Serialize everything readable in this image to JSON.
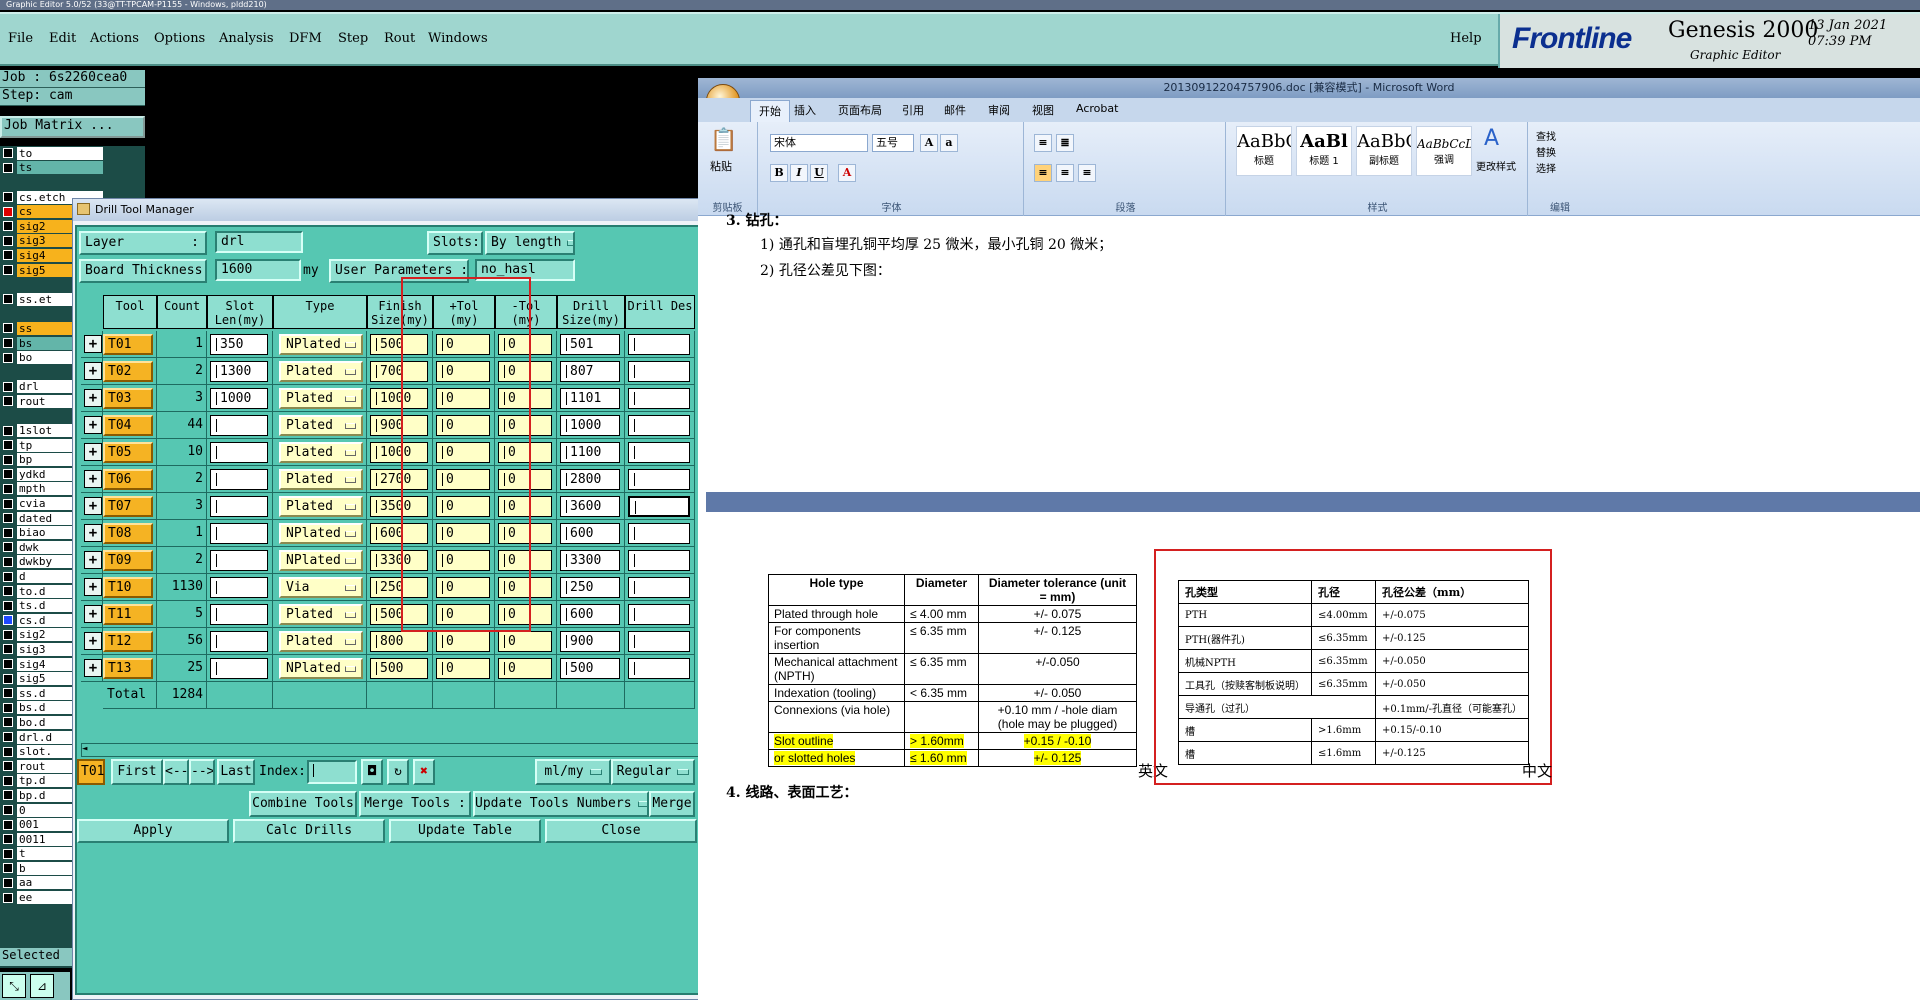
{
  "os_title": "Graphic Editor 5.0/52 (33@TT-TPCAM-P1155 - Windows, pldd210)",
  "genesis": {
    "menu": [
      "File",
      "Edit",
      "Actions",
      "Options",
      "Analysis",
      "DFM",
      "Step",
      "Rout",
      "Windows"
    ],
    "help": "Help",
    "brand_logo": "Frontline",
    "product": "Genesis 2000",
    "product_sub": "Graphic Editor",
    "date": "13 Jan 2021",
    "time": "07:39 PM",
    "job": "Job : 6s2260cea0",
    "step": "Step: cam",
    "job_matrix": "Job Matrix ...",
    "selected": "Selected",
    "layers": [
      {
        "name": "to",
        "style": "white",
        "cb": "off"
      },
      {
        "name": "ts",
        "style": "teal",
        "cb": "off"
      },
      {
        "name": "",
        "style": "blank",
        "cb": "none"
      },
      {
        "name": "cs.etch",
        "style": "white",
        "cb": "off"
      },
      {
        "name": "cs",
        "style": "orange",
        "cb": "red"
      },
      {
        "name": "sig2",
        "style": "orange",
        "cb": "off"
      },
      {
        "name": "sig3",
        "style": "orange",
        "cb": "off"
      },
      {
        "name": "sig4",
        "style": "orange",
        "cb": "off"
      },
      {
        "name": "sig5",
        "style": "orange",
        "cb": "off"
      },
      {
        "name": "",
        "style": "blank",
        "cb": "none"
      },
      {
        "name": "ss.et",
        "style": "white",
        "cb": "off"
      },
      {
        "name": "",
        "style": "blank",
        "cb": "none"
      },
      {
        "name": "ss",
        "style": "orange",
        "cb": "off"
      },
      {
        "name": "bs",
        "style": "teal",
        "cb": "off"
      },
      {
        "name": "bo",
        "style": "white",
        "cb": "off"
      },
      {
        "name": "",
        "style": "blank",
        "cb": "none"
      },
      {
        "name": "drl",
        "style": "white",
        "cb": "off"
      },
      {
        "name": "rout",
        "style": "white",
        "cb": "off"
      },
      {
        "name": "",
        "style": "blank",
        "cb": "none"
      },
      {
        "name": "1slot",
        "style": "white",
        "cb": "off"
      },
      {
        "name": "tp",
        "style": "white",
        "cb": "off"
      },
      {
        "name": "bp",
        "style": "white",
        "cb": "off"
      },
      {
        "name": "ydkd",
        "style": "white",
        "cb": "off"
      },
      {
        "name": "mpth",
        "style": "white",
        "cb": "off"
      },
      {
        "name": "cvia",
        "style": "white",
        "cb": "off"
      },
      {
        "name": "dated",
        "style": "white",
        "cb": "off"
      },
      {
        "name": "biao",
        "style": "white",
        "cb": "off"
      },
      {
        "name": "dwk",
        "style": "white",
        "cb": "off"
      },
      {
        "name": "dwkby",
        "style": "white",
        "cb": "off"
      },
      {
        "name": "d",
        "style": "white",
        "cb": "off"
      },
      {
        "name": "to.d",
        "style": "white",
        "cb": "off"
      },
      {
        "name": "ts.d",
        "style": "white",
        "cb": "off"
      },
      {
        "name": "cs.d",
        "style": "white",
        "cb": "on"
      },
      {
        "name": "sig2",
        "style": "white",
        "cb": "off"
      },
      {
        "name": "sig3",
        "style": "white",
        "cb": "off"
      },
      {
        "name": "sig4",
        "style": "white",
        "cb": "off"
      },
      {
        "name": "sig5",
        "style": "white",
        "cb": "off"
      },
      {
        "name": "ss.d",
        "style": "white",
        "cb": "off"
      },
      {
        "name": "bs.d",
        "style": "white",
        "cb": "off"
      },
      {
        "name": "bo.d",
        "style": "white",
        "cb": "off"
      },
      {
        "name": "drl.d",
        "style": "white",
        "cb": "off"
      },
      {
        "name": "slot.",
        "style": "white",
        "cb": "off"
      },
      {
        "name": "rout",
        "style": "white",
        "cb": "off"
      },
      {
        "name": "tp.d",
        "style": "white",
        "cb": "off"
      },
      {
        "name": "bp.d",
        "style": "white",
        "cb": "off"
      },
      {
        "name": "0",
        "style": "white",
        "cb": "off"
      },
      {
        "name": "001",
        "style": "white",
        "cb": "off"
      },
      {
        "name": "0011",
        "style": "white",
        "cb": "off"
      },
      {
        "name": "t",
        "style": "white",
        "cb": "off"
      },
      {
        "name": "b",
        "style": "white",
        "cb": "off"
      },
      {
        "name": "aa",
        "style": "white",
        "cb": "off"
      },
      {
        "name": "ee",
        "style": "white",
        "cb": "off"
      }
    ]
  },
  "drill_tool_manager": {
    "title": "Drill Tool Manager",
    "layer_label": "Layer",
    "layer_value": "drl",
    "slots_label": "Slots:",
    "slots_value": "By length",
    "board_thickness_label": "Board Thickness :",
    "board_thickness_value": "1600",
    "board_thickness_unit": "my",
    "user_params_label": "User Parameters :",
    "user_params_value": "no_hasl",
    "columns": [
      "Tool",
      "Count",
      "Slot Len(my)",
      "Type",
      "Finish Size(my)",
      "+Tol (my)",
      "-Tol (my)",
      "Drill Size(my)",
      "Drill Des"
    ],
    "rows": [
      {
        "tool": "T01",
        "count": "1",
        "slot": "350",
        "type": "NPlated",
        "finish": "500",
        "ptol": "0",
        "mtol": "0",
        "drill": "501"
      },
      {
        "tool": "T02",
        "count": "2",
        "slot": "1300",
        "type": "Plated",
        "finish": "700",
        "ptol": "0",
        "mtol": "0",
        "drill": "807"
      },
      {
        "tool": "T03",
        "count": "3",
        "slot": "1000",
        "type": "Plated",
        "finish": "1000",
        "ptol": "0",
        "mtol": "0",
        "drill": "1101"
      },
      {
        "tool": "T04",
        "count": "44",
        "slot": "",
        "type": "Plated",
        "finish": "900",
        "ptol": "0",
        "mtol": "0",
        "drill": "1000"
      },
      {
        "tool": "T05",
        "count": "10",
        "slot": "",
        "type": "Plated",
        "finish": "1000",
        "ptol": "0",
        "mtol": "0",
        "drill": "1100"
      },
      {
        "tool": "T06",
        "count": "2",
        "slot": "",
        "type": "Plated",
        "finish": "2700",
        "ptol": "0",
        "mtol": "0",
        "drill": "2800"
      },
      {
        "tool": "T07",
        "count": "3",
        "slot": "",
        "type": "Plated",
        "finish": "3500",
        "ptol": "0",
        "mtol": "0",
        "drill": "3600"
      },
      {
        "tool": "T08",
        "count": "1",
        "slot": "",
        "type": "NPlated",
        "finish": "600",
        "ptol": "0",
        "mtol": "0",
        "drill": "600"
      },
      {
        "tool": "T09",
        "count": "2",
        "slot": "",
        "type": "NPlated",
        "finish": "3300",
        "ptol": "0",
        "mtol": "0",
        "drill": "3300"
      },
      {
        "tool": "T10",
        "count": "1130",
        "slot": "",
        "type": "Via",
        "finish": "250",
        "ptol": "0",
        "mtol": "0",
        "drill": "250"
      },
      {
        "tool": "T11",
        "count": "5",
        "slot": "",
        "type": "Plated",
        "finish": "500",
        "ptol": "0",
        "mtol": "0",
        "drill": "600"
      },
      {
        "tool": "T12",
        "count": "56",
        "slot": "",
        "type": "Plated",
        "finish": "800",
        "ptol": "0",
        "mtol": "0",
        "drill": "900"
      },
      {
        "tool": "T13",
        "count": "25",
        "slot": "",
        "type": "NPlated",
        "finish": "500",
        "ptol": "0",
        "mtol": "0",
        "drill": "500"
      }
    ],
    "total_label": "Total",
    "total_value": "1284",
    "current_tool": "T01",
    "nav": {
      "first": "First",
      "prev": "<--",
      "next": "-->",
      "last": "Last",
      "index": "Index:"
    },
    "units": "ml/my",
    "mode": "Regular",
    "actions": {
      "combine": "Combine Tools",
      "merge_tools": "Merge Tools :",
      "update_numbers": "Update Tools Numbers",
      "merge": "Merge"
    },
    "footer": {
      "apply": "Apply",
      "calc": "Calc Drills",
      "update": "Update Table",
      "close": "Close"
    }
  },
  "word": {
    "title": "20130912204757906.doc [兼容模式] - Microsoft Word",
    "tabs": [
      "开始",
      "插入",
      "页面布局",
      "引用",
      "邮件",
      "审阅",
      "视图",
      "Acrobat"
    ],
    "font_name": "宋体",
    "font_size": "五号",
    "paste": "粘贴",
    "groups": [
      "剪贴板",
      "字体",
      "段落",
      "样式",
      "编辑"
    ],
    "styles": [
      {
        "preview": "AaBbC",
        "name": "标题"
      },
      {
        "preview": "AaBl",
        "name": "标题 1"
      },
      {
        "preview": "AaBbC",
        "name": "副标题"
      },
      {
        "preview": "AaBbCcD",
        "name": "强调"
      }
    ],
    "change_styles": "更改样式",
    "edit_items": [
      "查找",
      "替换",
      "选择"
    ],
    "heading3": "3.   钻孔：",
    "line1": "1)   通孔和盲埋孔铜平均厚 25 微米，最小孔铜 20 微米；",
    "line2": "2)   孔径公差见下图：",
    "heading4": "4.   线路、表面工艺：",
    "label_en": "英文",
    "label_cn": "中文",
    "table_en": {
      "headers": [
        "Hole type",
        "Diameter",
        "Diameter tolerance (unit = mm)"
      ],
      "rows": [
        [
          "Plated through hole",
          "≤ 4.00 mm",
          "+/- 0.075"
        ],
        [
          "For components insertion",
          "≤ 6.35 mm",
          "+/- 0.125"
        ],
        [
          "Mechanical attachment (NPTH)",
          "≤ 6.35 mm",
          "+/-0.050"
        ],
        [
          "Indexation (tooling)",
          "< 6.35 mm",
          "+/- 0.050"
        ],
        [
          "Connexions (via hole)",
          "",
          "+0.10 mm / -hole diam (hole may be plugged)"
        ],
        [
          "Slot outline",
          "> 1.60mm",
          "+0.15 / -0.10"
        ],
        [
          "or slotted holes",
          "≤ 1.60 mm",
          "+/- 0.125"
        ]
      ]
    },
    "table_cn": {
      "headers": [
        "孔类型",
        "孔径",
        "孔径公差（mm）"
      ],
      "rows": [
        [
          "PTH",
          "≤4.00mm",
          "+/-0.075"
        ],
        [
          "PTH(器件孔)",
          "≤6.35mm",
          "+/-0.125"
        ],
        [
          "机械NPTH",
          "≤6.35mm",
          "+/-0.050"
        ],
        [
          "工具孔（按赎客制板说明）",
          "≤6.35mm",
          "+/-0.050"
        ],
        [
          "导通孔（过孔）",
          "",
          "+0.1mm/-孔直径（可能塞孔）"
        ],
        [
          "槽",
          ">1.6mm",
          "+0.15/-0.10"
        ],
        [
          "槽",
          "≤1.6mm",
          "+/-0.125"
        ]
      ]
    }
  }
}
